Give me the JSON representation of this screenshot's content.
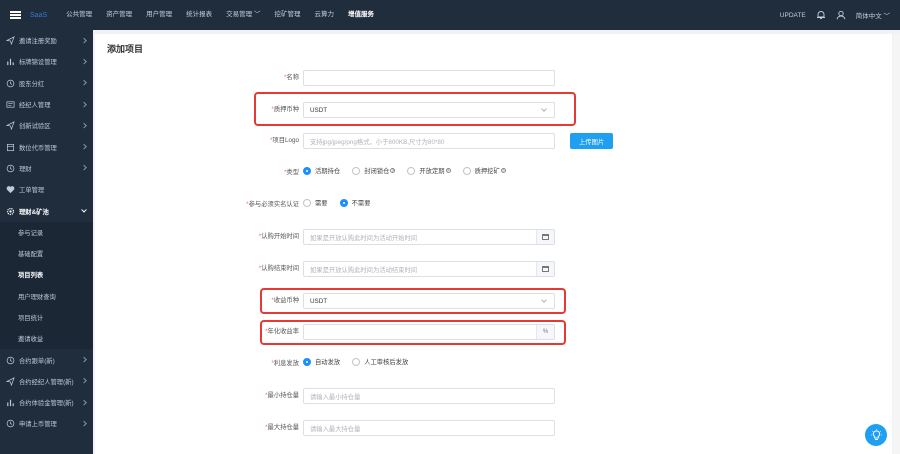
{
  "topbar": {
    "brand": "SaaS",
    "nav": [
      "公共管理",
      "资产管理",
      "用户管理",
      "统计报表",
      "交易管理",
      "挖矿管理",
      "云算力",
      "增值服务"
    ],
    "active_index": 7,
    "update_label": "UPDATE",
    "lang_label": "简体中文"
  },
  "sidebar": {
    "items": [
      {
        "label": "邀请注册奖励",
        "icon": "send-icon"
      },
      {
        "label": "标牌锦设管理",
        "icon": "bar-chart-icon"
      },
      {
        "label": "股东分红",
        "icon": "clock-icon"
      },
      {
        "label": "经纪人管理",
        "icon": "card-icon"
      },
      {
        "label": "创新试验区",
        "icon": "send-icon"
      },
      {
        "label": "数位代币管理",
        "icon": "box-icon"
      },
      {
        "label": "理财",
        "icon": "clock-icon"
      },
      {
        "label": "工单管理",
        "icon": "heart-icon"
      },
      {
        "label": "理财&矿池",
        "icon": "gear-icon"
      }
    ],
    "submenu": [
      "参与记录",
      "基础配置",
      "项目列表",
      "用户理财查询",
      "项目统计",
      "邀请收益"
    ],
    "current_sub": 2,
    "after": [
      {
        "label": "合约跟单(新)",
        "icon": "clock-icon"
      },
      {
        "label": "合约经纪人管理(新)",
        "icon": "send-icon"
      },
      {
        "label": "合约体验金管理(新)",
        "icon": "bar-chart-icon"
      },
      {
        "label": "申请上币管理",
        "icon": "clock-icon"
      }
    ]
  },
  "page": {
    "title": "添加项目",
    "fields": {
      "name": {
        "label": "名称",
        "value": ""
      },
      "currency": {
        "label": "质押币种",
        "value": "USDT"
      },
      "logo": {
        "label": "项目Logo",
        "placeholder": "支持jpg/jpeg/png格式，小于800KB,尺寸为80*80",
        "upload": "上传图片"
      },
      "type": {
        "label": "类型",
        "options": [
          "活期持仓",
          "封闭锁仓",
          "开放定期",
          "质押挖矿"
        ],
        "selected": 0
      },
      "realname": {
        "label": "参与必须实名认证",
        "options": [
          "需要",
          "不需要"
        ],
        "selected": 1
      },
      "start": {
        "label": "认购开始时间",
        "placeholder": "如果是开放认购此时间为活动开始时间"
      },
      "end": {
        "label": "认购结束时间",
        "placeholder": "如果是开放认购此时间为活动结束时间"
      },
      "income_currency": {
        "label": "收益币种",
        "value": "USDT"
      },
      "apr": {
        "label": "年化收益率",
        "value": "",
        "suffix": "%"
      },
      "payout": {
        "label": "利息发放",
        "options": [
          "自动发放",
          "人工审核后发放"
        ],
        "selected": 0
      },
      "min_hold": {
        "label": "最小持仓量",
        "placeholder": "请输入最小持仓量"
      },
      "max_hold": {
        "label": "最大持仓量",
        "placeholder": "请输入最大持仓量"
      }
    }
  },
  "colors": {
    "accent": "#1e9ff2",
    "highlight": "#e53935",
    "sidebar": "#1f2d3d"
  }
}
